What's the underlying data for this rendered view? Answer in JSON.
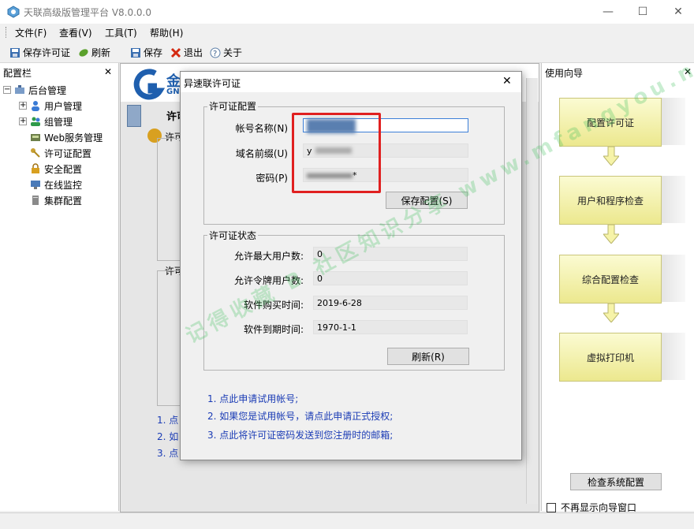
{
  "window": {
    "title": "天联高级版管理平台 V8.0.0.0",
    "minimize": "—",
    "maximize": "☐",
    "close": "✕"
  },
  "menu": [
    "文件(F)",
    "查看(V)",
    "工具(T)",
    "帮助(H)"
  ],
  "toolbar": {
    "save_license": "保存许可证",
    "refresh": "刷新",
    "save": "保存",
    "exit": "退出",
    "about": "关于"
  },
  "left_panel": {
    "title": "配置栏",
    "close": "✕",
    "root": "后台管理",
    "items": [
      "用户管理",
      "组管理",
      "Web服务管理",
      "许可证配置",
      "安全配置",
      "在线监控",
      "集群配置"
    ]
  },
  "center_back": {
    "logo_top": "金",
    "logo_sub": "GN",
    "heading_partial": "许可",
    "sub_partial_1": "许可",
    "sub_partial_2": "许可",
    "list_partial": [
      "1. 点",
      "2. 如",
      "3. 点"
    ]
  },
  "right_panel": {
    "title": "使用向导",
    "close": "✕",
    "steps": [
      "配置许可证",
      "用户和程序检查",
      "综合配置检查",
      "虚拟打印机"
    ],
    "check_button": "检查系统配置",
    "dont_show_label": "不再显示向导窗口"
  },
  "dialog": {
    "title": "异速联许可证",
    "close": "✕",
    "config_group": "许可证配置",
    "account_label": "帐号名称(N)",
    "account_value": "xxxxxxxx",
    "domain_label": "域名前缀(U)",
    "domain_value": "y",
    "password_label": "密码(P)",
    "password_value": "*",
    "save_config": "保存配置(S)",
    "status_group": "许可证状态",
    "max_users_label": "允许最大用户数:",
    "max_users_value": "0",
    "token_users_label": "允许令牌用户数:",
    "token_users_value": "0",
    "purchase_label": "软件购买时间:",
    "purchase_value": "2019-6-28",
    "expire_label": "软件到期时间:",
    "expire_value": "1970-1-1",
    "refresh_button": "刷新(R)",
    "links": [
      "1. 点此申请试用帐号;",
      "2. 如果您是试用帐号，请点此申请正式授权;",
      "3. 点此将许可证密码发送到您注册时的邮箱;"
    ]
  },
  "watermark": "记得收藏 B 社区知识分享 www.mfangyou.net",
  "colors": {
    "highlight_red": "#e02020",
    "step_fill": "#f3f0b0",
    "link_blue": "#1a3bb5",
    "arrow_fill": "#f6f3a8"
  }
}
